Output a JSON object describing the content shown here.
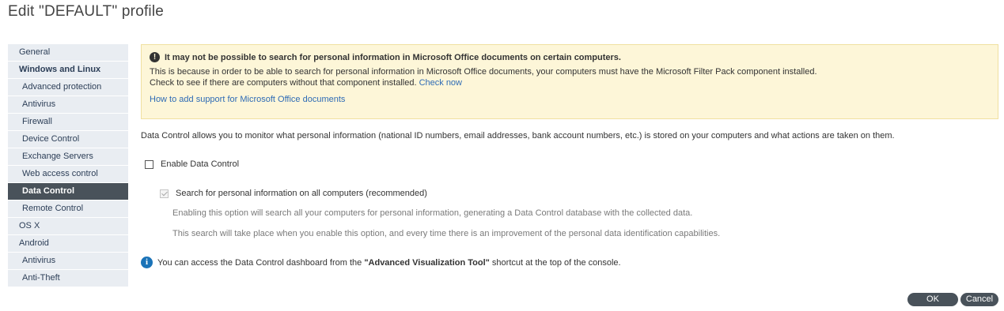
{
  "page": {
    "title": "Edit \"DEFAULT\" profile"
  },
  "sidebar": {
    "items": [
      {
        "label": "General"
      },
      {
        "label": "Windows and Linux"
      },
      {
        "label": "Advanced protection"
      },
      {
        "label": "Antivirus"
      },
      {
        "label": "Firewall"
      },
      {
        "label": "Device Control"
      },
      {
        "label": "Exchange Servers"
      },
      {
        "label": "Web access control"
      },
      {
        "label": "Data Control"
      },
      {
        "label": "Remote Control"
      },
      {
        "label": "OS X"
      },
      {
        "label": "Android"
      },
      {
        "label": "Antivirus"
      },
      {
        "label": "Anti-Theft"
      }
    ]
  },
  "warning": {
    "icon": "exclamation-icon",
    "title": "It may not be possible to search for personal information in Microsoft Office documents on certain computers.",
    "line1": "This is because in order to be able to search for personal information in Microsoft Office documents, your computers must have the Microsoft Filter Pack component installed.",
    "line2": "Check to see if there are computers without that component installed.",
    "check_link": "Check now",
    "howto_link": "How to add support for Microsoft Office documents"
  },
  "main": {
    "description": "Data Control allows you to monitor what personal information (national ID numbers, email addresses, bank account numbers, etc.) is stored on your computers and what actions are taken on them.",
    "enable_label": "Enable Data Control",
    "enable_checked": false,
    "search_label": "Search for personal information on all computers (recommended)",
    "search_checked": true,
    "hint1": "Enabling this option will search all your computers for personal information, generating a Data Control database with the collected data.",
    "hint2": "This search will take place when you enable this option, and every time there is an improvement of the personal data identification capabilities.",
    "info_prefix": "You can access the Data Control dashboard from the ",
    "info_bold": "\"Advanced Visualization Tool\"",
    "info_suffix": " shortcut at the top of the console."
  },
  "buttons": {
    "ok": "OK",
    "cancel": "Cancel"
  },
  "colors": {
    "accent": "#49525a",
    "link": "#2e6bb5",
    "warning_bg": "#fdf6d8",
    "sidebar_bg": "#e9edf2",
    "info": "#1a73b8"
  }
}
